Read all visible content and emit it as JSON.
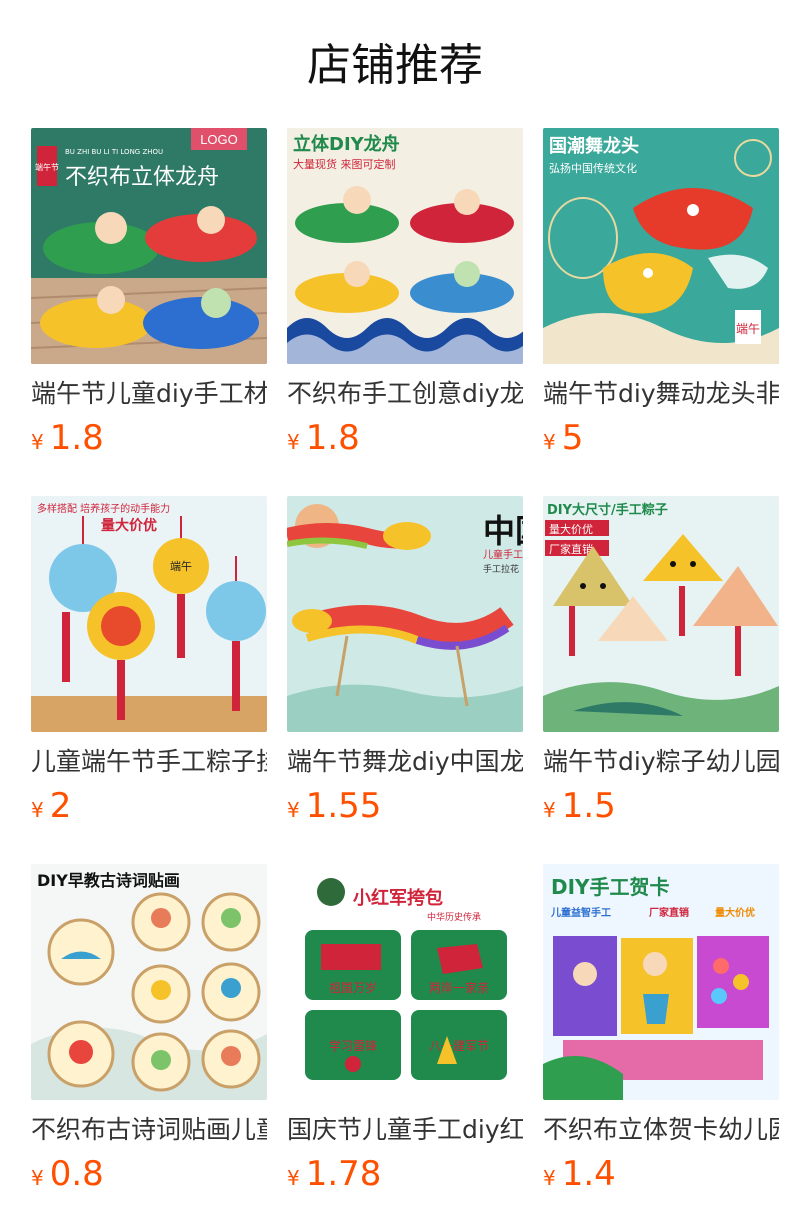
{
  "page": {
    "title": "店铺推荐"
  },
  "products": [
    {
      "name": "端午节儿童diy手工材料包",
      "currency": "¥",
      "price": "1.8",
      "image_text": [
        "LOGO",
        "端午节",
        "不织布立体龙舟",
        "BU ZHI BU LI TI LONG ZHOU"
      ],
      "bg": "#2f7a66"
    },
    {
      "name": "不织布手工创意diy龙舟",
      "currency": "¥",
      "price": "1.8",
      "image_text": [
        "立体DIY龙舟",
        "大量现货 来图可定制"
      ],
      "bg": "#f3efe3"
    },
    {
      "name": "端午节diy舞动龙头非遗",
      "currency": "¥",
      "price": "5",
      "image_text": [
        "国潮舞龙头",
        "弘扬中国传统文化",
        "端午"
      ],
      "bg": "#3aa89a"
    },
    {
      "name": "儿童端午节手工粽子挂饰",
      "currency": "¥",
      "price": "2",
      "image_text": [
        "多样搭配 培养孩子的动手能力",
        "量大价优",
        "端午"
      ],
      "bg": "#eaf3f6"
    },
    {
      "name": "端午节舞龙diy中国龙",
      "currency": "¥",
      "price": "1.55",
      "image_text": [
        "中国龙",
        "儿童手工",
        "手工拉花"
      ],
      "bg": "#cfe9e6"
    },
    {
      "name": "端午节diy粽子幼儿园",
      "currency": "¥",
      "price": "1.5",
      "image_text": [
        "DIY大尺寸/手工粽子",
        "量大价优",
        "厂家直销"
      ],
      "bg": "#e6f3f2"
    },
    {
      "name": "不织布古诗词贴画儿童",
      "currency": "¥",
      "price": "0.8",
      "image_text": [
        "DIY早教古诗词贴画"
      ],
      "bg": "#f4f7f5"
    },
    {
      "name": "国庆节儿童手工diy红军",
      "currency": "¥",
      "price": "1.78",
      "image_text": [
        "小红军挎包",
        "中华历史传承",
        "祖国万岁",
        "两岸一家亲",
        "学习雷锋",
        "八一建军节"
      ],
      "bg": "#ffffff"
    },
    {
      "name": "不织布立体贺卡幼儿园",
      "currency": "¥",
      "price": "1.4",
      "image_text": [
        "DIY手工贺卡",
        "儿童益智手工",
        "厂家直销",
        "量大价优"
      ],
      "bg": "#eef7ff"
    }
  ]
}
